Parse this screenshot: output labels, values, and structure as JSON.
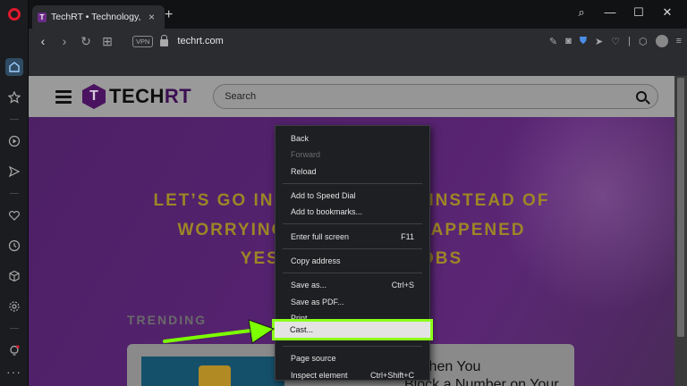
{
  "browser": {
    "tab_title": "TechRT • Technology, Real",
    "tab_close": "×",
    "new_tab": "+",
    "win_minimize": "—",
    "win_maximize": "☐",
    "win_close": "✕",
    "vpn_label": "VPN",
    "url": "techrt.com",
    "icons": [
      "back-icon",
      "forward-icon",
      "reload-icon",
      "tiles-icon",
      "edit-icon",
      "camera-icon",
      "shield-icon",
      "send-icon",
      "heart-icon",
      "cube-icon",
      "avatar"
    ]
  },
  "sidebar": {
    "items": [
      "home-icon",
      "star-icon",
      "player-icon",
      "send-icon",
      "heart-icon",
      "history-icon",
      "cube-icon",
      "settings-icon",
      "lightbulb-icon"
    ],
    "more": "···"
  },
  "page": {
    "logo_letter": "T",
    "logo_text_1": "TECH",
    "logo_text_2": "RT",
    "search_placeholder": "Search",
    "quote_line1": "LET’S GO INV                  W INSTEAD OF",
    "quote_line2": "WORRYING                    HAPPENED",
    "quote_line3": "YEST                  JOBS",
    "trending": "TRENDING",
    "card_title": "s When You",
    "card_subtitle": "Block a Number on Your"
  },
  "context_menu": {
    "items": [
      {
        "label": "Back",
        "shortcut": "",
        "enabled": true
      },
      {
        "label": "Forward",
        "shortcut": "",
        "enabled": false
      },
      {
        "label": "Reload",
        "shortcut": "",
        "enabled": true
      },
      {
        "sep": true
      },
      {
        "label": "Add to Speed Dial",
        "shortcut": "",
        "enabled": true
      },
      {
        "label": "Add to bookmarks...",
        "shortcut": "",
        "enabled": true
      },
      {
        "sep": true
      },
      {
        "label": "Enter full screen",
        "shortcut": "F11",
        "enabled": true
      },
      {
        "sep": true
      },
      {
        "label": "Copy address",
        "shortcut": "",
        "enabled": true
      },
      {
        "sep": true
      },
      {
        "label": "Save as...",
        "shortcut": "Ctrl+S",
        "enabled": true
      },
      {
        "label": "Save as PDF...",
        "shortcut": "",
        "enabled": true
      },
      {
        "label": "Print...",
        "shortcut": "",
        "enabled": true
      },
      {
        "label": "Cast...",
        "shortcut": "",
        "enabled": true,
        "highlighted": true
      },
      {
        "sep": true
      },
      {
        "label": "Page source",
        "shortcut": "",
        "enabled": true
      },
      {
        "label": "Inspect element",
        "shortcut": "Ctrl+Shift+C",
        "enabled": true
      }
    ]
  },
  "colors": {
    "highlight_border": "#8cff1a",
    "arrow": "#7cff00",
    "brand_purple": "#4a1360",
    "quote_gold": "#9d8626"
  }
}
